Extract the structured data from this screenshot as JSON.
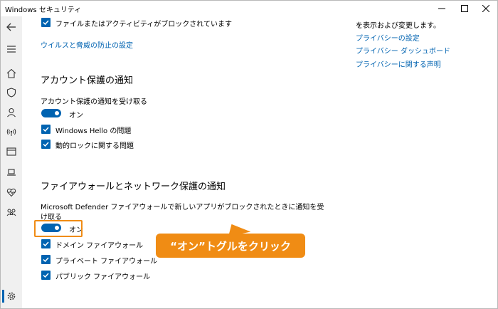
{
  "window": {
    "title": "Windows セキュリティ"
  },
  "sidebar": {
    "icons": [
      "back-arrow-icon",
      "hamburger-menu-icon",
      "home-icon",
      "shield-icon",
      "person-icon",
      "wifi-antenna-icon",
      "app-window-icon",
      "laptop-icon",
      "heart-pulse-icon",
      "family-icon",
      "gear-icon"
    ]
  },
  "main": {
    "top_checkbox": "ファイルまたはアクティビティがブロックされています",
    "virus_link": "ウイルスと脅威の防止の設定",
    "right_panel": {
      "text": "を表示および変更します。",
      "links": [
        "プライバシーの設定",
        "プライバシー ダッシュボード",
        "プライバシーに関する声明"
      ]
    },
    "account": {
      "heading": "アカウント保護の通知",
      "receive_label": "アカウント保護の通知を受け取る",
      "toggle_label": "オン",
      "checks": [
        "Windows Hello の問題",
        "動的ロックに関する問題"
      ]
    },
    "firewall": {
      "heading": "ファイアウォールとネットワーク保護の通知",
      "description_line1": "Microsoft Defender ファイアウォールで新しいアプリがブロックされたときに通知を受",
      "description_line2": "け取る",
      "toggle_label": "オン",
      "checks": [
        "ドメイン ファイアウォール",
        "プライベート ファイアウォール",
        "パブリック ファイアウォール"
      ]
    }
  },
  "callout": {
    "text": "“オン”トグルをクリック"
  },
  "colors": {
    "accent": "#0063b1",
    "callout": "#f08c14"
  }
}
